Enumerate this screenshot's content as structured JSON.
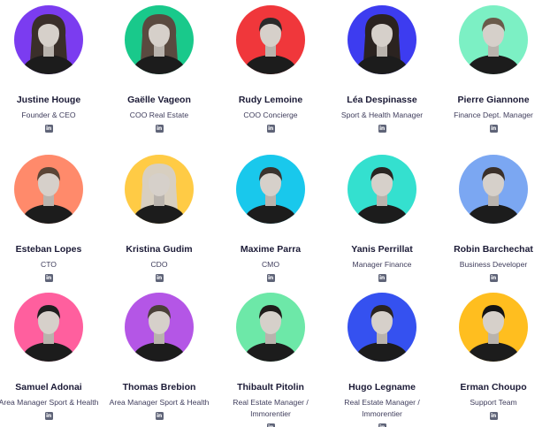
{
  "team": [
    {
      "name": "Justine Houge",
      "role": "Founder & CEO",
      "color": "#7b3cf0",
      "hair": "#3a2f2a",
      "long": true
    },
    {
      "name": "Gaëlle Vageon",
      "role": "COO Real Estate",
      "color": "#19c98b",
      "hair": "#5a4a40",
      "long": true
    },
    {
      "name": "Rudy Lemoine",
      "role": "COO Concierge",
      "color": "#f0373b",
      "hair": "#2a2a2a",
      "long": false
    },
    {
      "name": "Léa Despinasse",
      "role": "Sport & Health Manager",
      "color": "#3d3cf0",
      "hair": "#2b2320",
      "long": true
    },
    {
      "name": "Pierre Giannone",
      "role": "Finance Dept. Manager",
      "color": "#7cf0c4",
      "hair": "#6a5a4a",
      "long": false
    },
    {
      "name": "Esteban Lopes",
      "role": "CTO",
      "color": "#ff8a6b",
      "hair": "#5a4536",
      "long": false
    },
    {
      "name": "Kristina Gudim",
      "role": "CDO",
      "color": "#ffcb45",
      "hair": "#d8cfc0",
      "long": true
    },
    {
      "name": "Maxime Parra",
      "role": "CMO",
      "color": "#19c8ec",
      "hair": "#3a332e",
      "long": false
    },
    {
      "name": "Yanis Perrillat",
      "role": "Manager Finance",
      "color": "#34e0cf",
      "hair": "#2a2522",
      "long": false
    },
    {
      "name": "Robin Barchechat",
      "role": "Business Developer",
      "color": "#7ba7f2",
      "hair": "#3b3029",
      "long": false
    },
    {
      "name": "Samuel Adonai",
      "role": "Area Manager Sport & Health",
      "color": "#ff5f9e",
      "hair": "#1f1f1f",
      "long": false
    },
    {
      "name": "Thomas Brebion",
      "role": "Area Manager Sport & Health",
      "color": "#b456e6",
      "hair": "#4a4038",
      "long": false
    },
    {
      "name": "Thibault Pitolin",
      "role": "Real Estate Manager / Immorentier",
      "color": "#6de8a8",
      "hair": "#1f1c1a",
      "long": false
    },
    {
      "name": "Hugo Legname",
      "role": "Real Estate Manager / Immorentier",
      "color": "#3551f0",
      "hair": "#2a2420",
      "long": false
    },
    {
      "name": "Erman Choupo",
      "role": "Support Team",
      "color": "#ffbe1f",
      "hair": "#141414",
      "long": false
    }
  ],
  "linkedin_label": "in",
  "linkedin_icon": "linkedin-icon"
}
